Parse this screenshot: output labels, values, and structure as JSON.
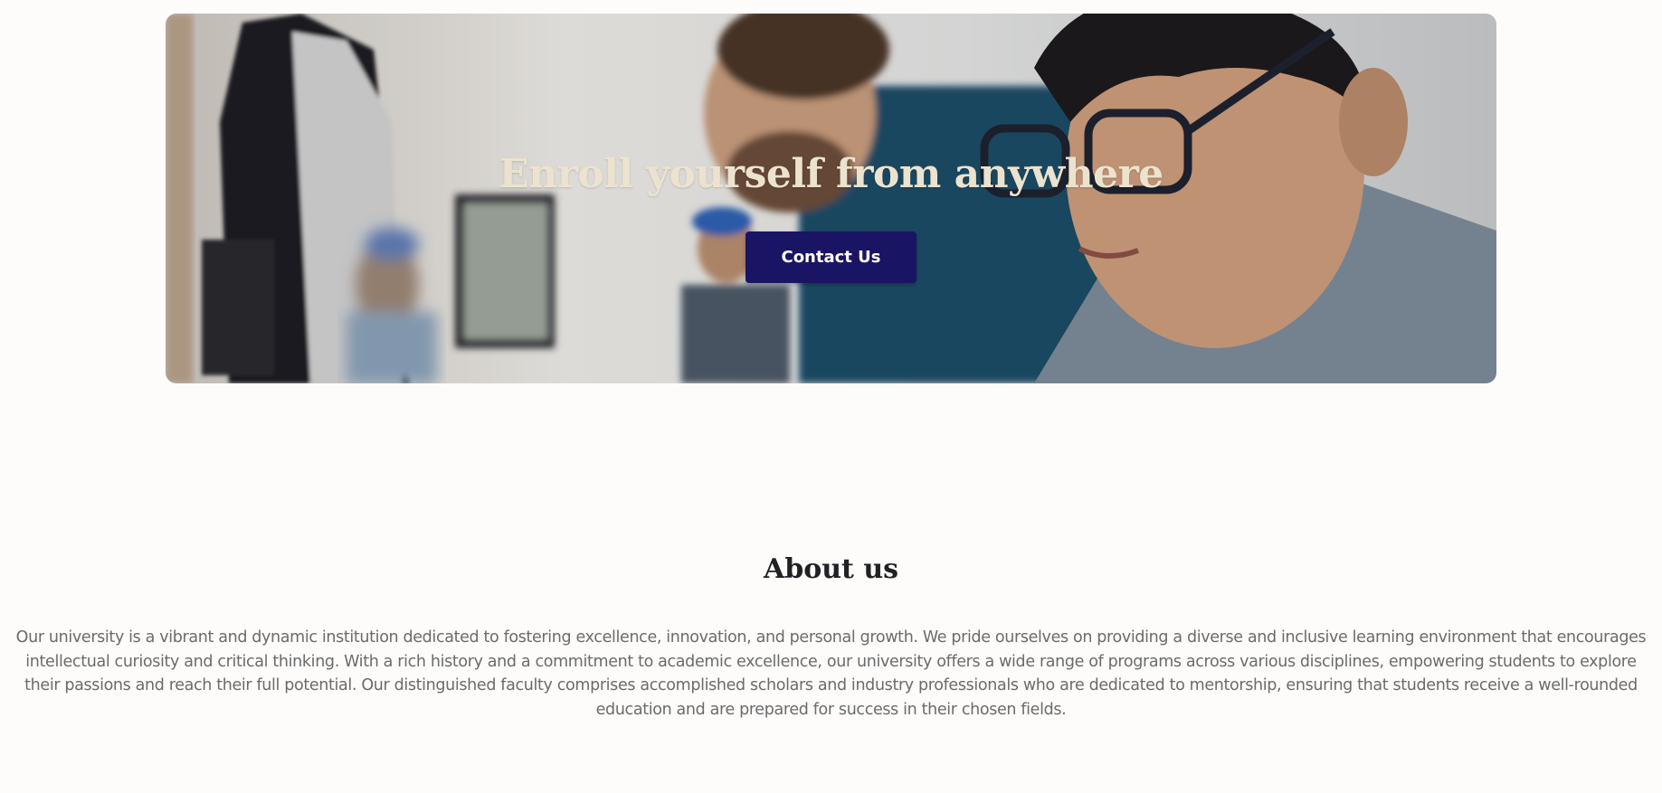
{
  "hero": {
    "title": "Enroll yourself from anywhere",
    "cta_label": "Contact Us",
    "cta_color": "#1a1464",
    "image": "students-at-computers-photo"
  },
  "about": {
    "title": "About us",
    "body": "Our university is a vibrant and dynamic institution dedicated to fostering excellence, innovation, and personal growth. We pride ourselves on providing a diverse and inclusive learning environment that encourages intellectual curiosity and critical thinking. With a rich history and a commitment to academic excellence, our university offers a wide range of programs across various disciplines, empowering students to explore their passions and reach their full potential. Our distinguished faculty comprises accomplished scholars and industry professionals who are dedicated to mentorship, ensuring that students receive a well-rounded education and are prepared for success in their chosen fields."
  }
}
